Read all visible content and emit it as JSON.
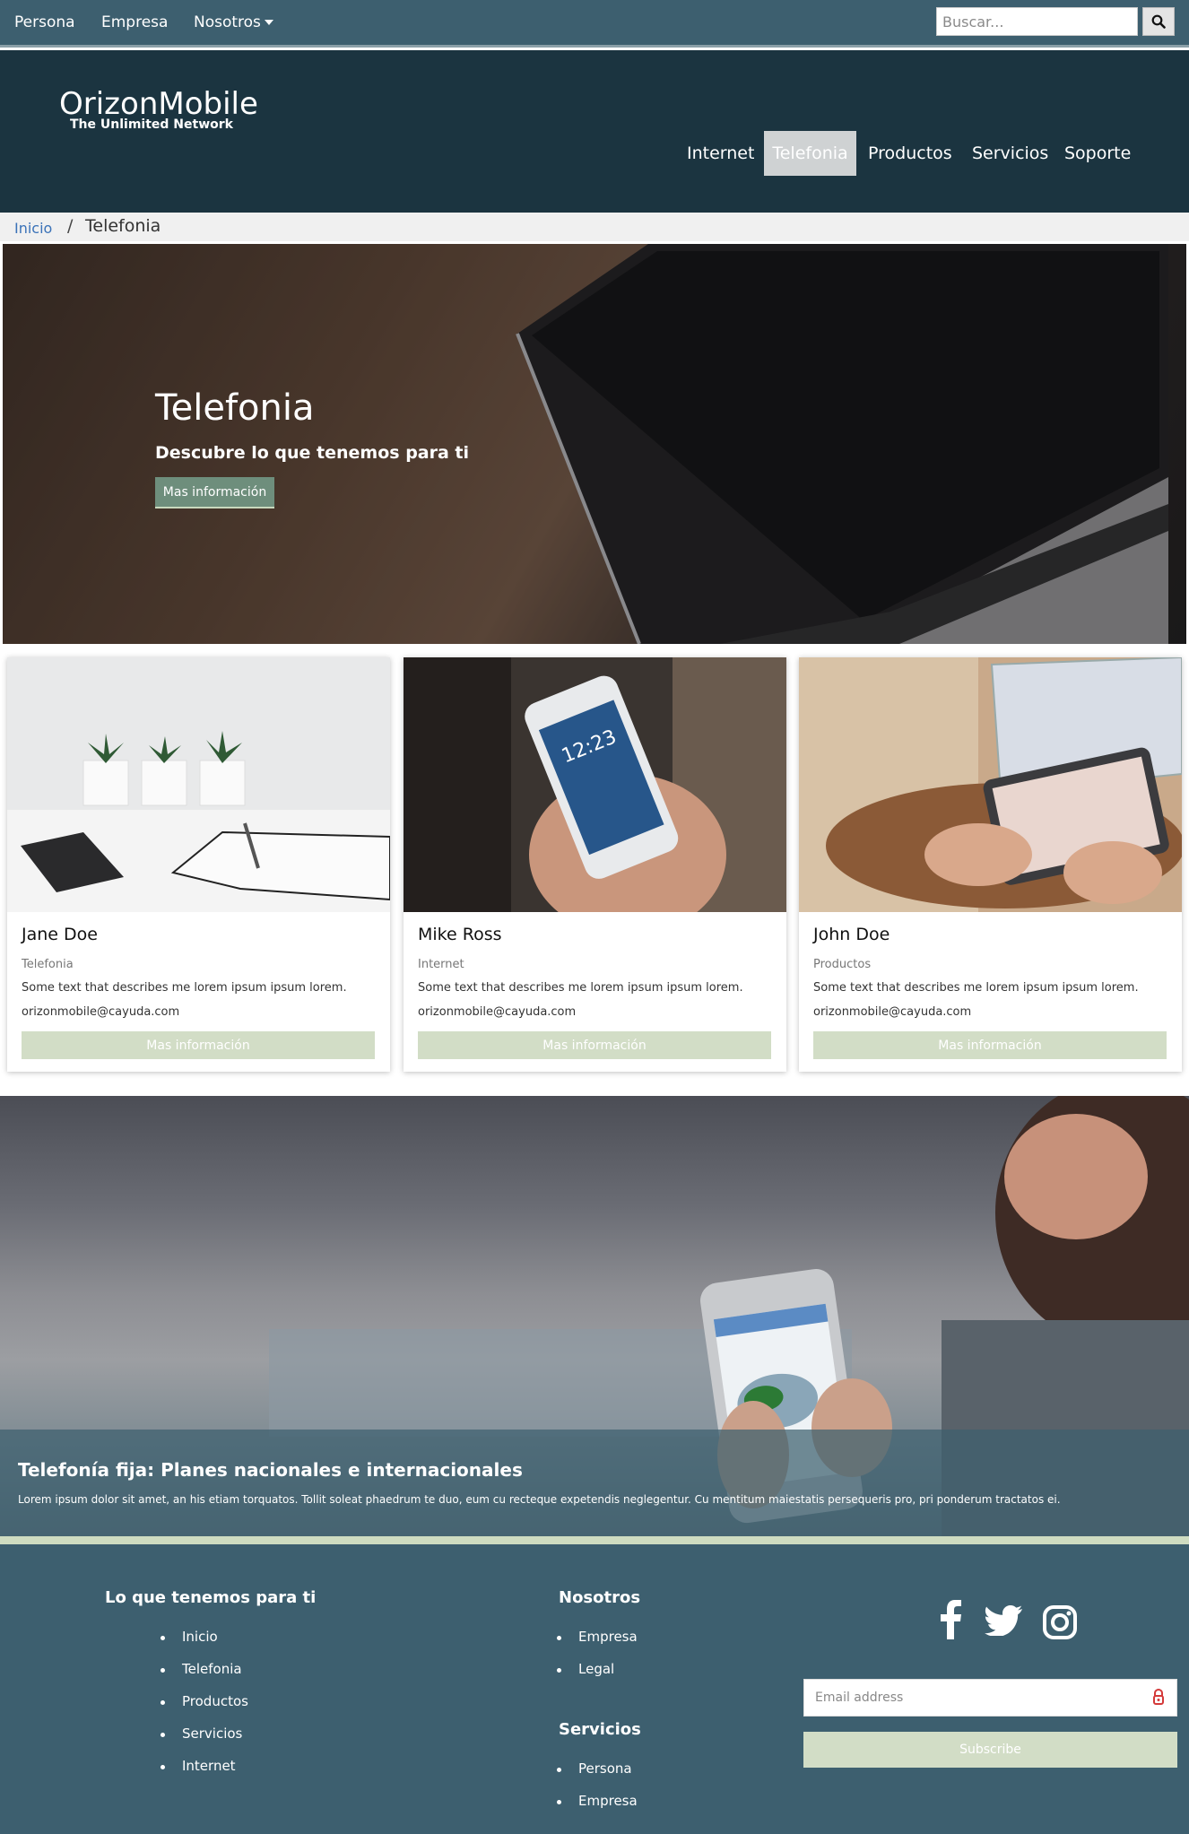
{
  "topbar": {
    "links": [
      "Persona",
      "Empresa",
      "Nosotros"
    ],
    "search_placeholder": "Buscar..."
  },
  "header": {
    "logo": "OrizonMobile",
    "tagline": "The Unlimited Network",
    "nav": [
      "Internet",
      "Telefonia",
      "Productos",
      "Servicios",
      "Soporte"
    ],
    "active_nav": "Telefonia"
  },
  "breadcrumb": {
    "home": "Inicio",
    "separator": "/",
    "current": "Telefonia"
  },
  "hero": {
    "title": "Telefonia",
    "subtitle": "Descubre lo que tenemos para ti",
    "button": "Mas información"
  },
  "cards": [
    {
      "name": "Jane Doe",
      "category": "Telefonia",
      "description": "Some text that describes me lorem ipsum ipsum lorem.",
      "email": "orizonmobile@cayuda.com",
      "button": "Mas información"
    },
    {
      "name": "Mike Ross",
      "category": "Internet",
      "description": "Some text that describes me lorem ipsum ipsum lorem.",
      "email": "orizonmobile@cayuda.com",
      "button": "Mas información"
    },
    {
      "name": "John Doe",
      "category": "Productos",
      "description": "Some text that describes me lorem ipsum ipsum lorem.",
      "email": "orizonmobile@cayuda.com",
      "button": "Mas información"
    }
  ],
  "banner": {
    "title": "Telefonía fija: Planes nacionales e internacionales",
    "text": "Lorem ipsum dolor sit amet, an his etiam torquatos. Tollit soleat phaedrum te duo, eum cu recteque expetendis neglegentur. Cu mentitum maiestatis persequeris pro, pri ponderum tractatos ei."
  },
  "footer": {
    "col1": {
      "heading": "Lo que tenemos para ti",
      "items": [
        "Inicio",
        "Telefonia",
        "Productos",
        "Servicios",
        "Internet"
      ]
    },
    "col2": {
      "heading": "Nosotros",
      "items": [
        "Empresa",
        "Legal"
      ]
    },
    "col3": {
      "heading": "Servicios",
      "items": [
        "Persona",
        "Empresa"
      ]
    },
    "social_icons": [
      "facebook-icon",
      "twitter-icon",
      "instagram-icon"
    ],
    "email_placeholder": "Email address",
    "subscribe": "Subscribe"
  },
  "colors": {
    "topbar": "#3d5f6f",
    "header": "#1b3440",
    "accent_green": "#d2ddc6",
    "footer": "#3d5f6f"
  }
}
